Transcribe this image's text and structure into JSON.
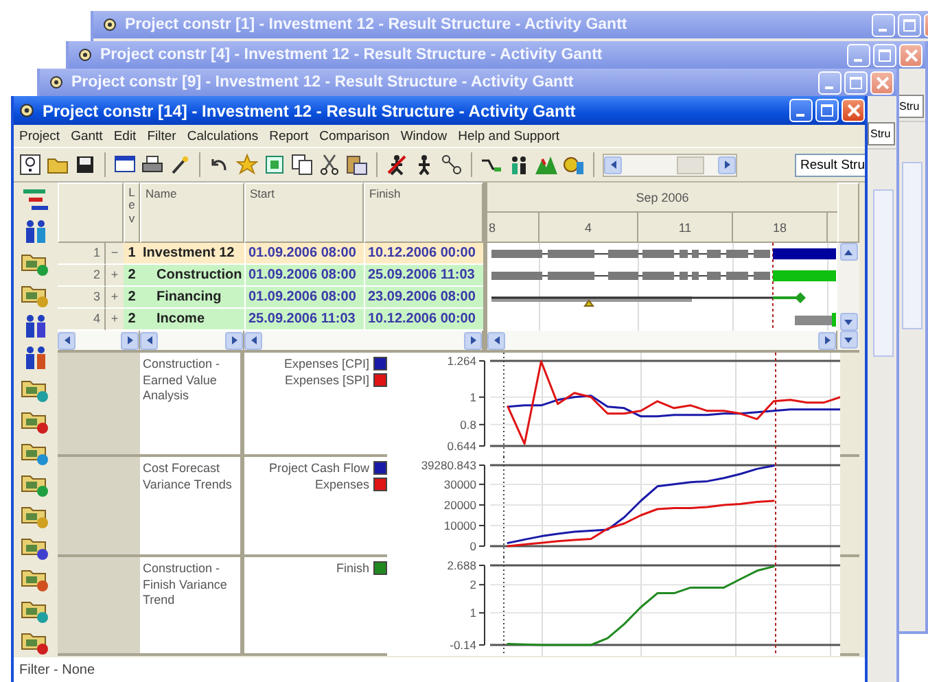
{
  "windows_behind": [
    {
      "title": "Project constr [1] - Investment 12 - Result Structure - Activity Gantt"
    },
    {
      "title": "Project constr [4] - Investment 12 - Result Structure - Activity Gantt",
      "dropdown_value": "Stru"
    },
    {
      "title": "Project constr [9] - Investment 12 - Result Structure - Activity Gantt",
      "dropdown_value": "Stru"
    }
  ],
  "window": {
    "title": "Project constr [14] - Investment 12 - Result Structure - Activity Gantt"
  },
  "menu": [
    "Project",
    "Gantt",
    "Edit",
    "Filter",
    "Calculations",
    "Report",
    "Comparison",
    "Window",
    "Help and Support"
  ],
  "toolbar": {
    "dropdown_value": "Result Stru"
  },
  "table": {
    "columns": [
      "Lev",
      "Name",
      "Start",
      "Finish"
    ],
    "rows": [
      {
        "number": "1",
        "toggle": "−",
        "lev": "1",
        "name": "Investment 12",
        "start": "01.09.2006 08:00",
        "finish": "10.12.2006 00:00",
        "kind": "summary",
        "bar": {
          "kind": "split-bar",
          "color": "#00009c"
        }
      },
      {
        "number": "2",
        "toggle": "+",
        "lev": "2",
        "name": "Construction",
        "start": "01.09.2006 08:00",
        "finish": "25.09.2006 11:03",
        "kind": "task",
        "bar": {
          "kind": "split-bar",
          "color": "#10c010"
        }
      },
      {
        "number": "3",
        "toggle": "+",
        "lev": "2",
        "name": "Financing",
        "start": "01.09.2006 08:00",
        "finish": "23.09.2006 08:00",
        "kind": "task",
        "bar": {
          "kind": "line",
          "color": "#20a020"
        }
      },
      {
        "number": "4",
        "toggle": "+",
        "lev": "2",
        "name": "Income",
        "start": "25.09.2006 11:03",
        "finish": "10.12.2006 00:00",
        "kind": "task",
        "bar": {
          "kind": "late-bar",
          "color": "#10c010"
        }
      }
    ]
  },
  "gantt": {
    "month": "Sep 2006",
    "days": [
      "8",
      "4",
      "11",
      "18"
    ]
  },
  "charts": [
    {
      "title": "Construction - Earned Value Analysis",
      "chart_data": {
        "type": "line",
        "grid": true,
        "legend": "left",
        "ylim": [
          0.644,
          1.264
        ],
        "yticks": [
          0.644,
          0.8,
          1,
          1.264
        ],
        "series": [
          {
            "name": "Expenses [CPI]",
            "color": "#1a1aa8",
            "values": [
              0.93,
              0.94,
              0.94,
              0.98,
              1.0,
              1.01,
              0.93,
              0.92,
              0.86,
              0.86,
              0.87,
              0.87,
              0.87,
              0.88,
              0.88,
              0.89,
              0.9,
              0.91,
              0.91,
              0.91,
              0.91
            ]
          },
          {
            "name": "Expenses [SPI]",
            "color": "#e01414",
            "values": [
              0.93,
              0.66,
              1.26,
              0.95,
              1.03,
              1.0,
              0.88,
              0.88,
              0.9,
              0.97,
              0.92,
              0.94,
              0.9,
              0.9,
              0.88,
              0.84,
              0.97,
              0.98,
              0.96,
              0.96,
              1.0
            ]
          }
        ]
      }
    },
    {
      "title": "Cost Forecast Variance Trends",
      "chart_data": {
        "type": "line",
        "grid": true,
        "legend": "left",
        "ylim": [
          0,
          39280.843
        ],
        "yticks": [
          0,
          10000,
          20000,
          30000,
          39280.843
        ],
        "series": [
          {
            "name": "Project Cash Flow",
            "color": "#1a1aa8",
            "values": [
              1500,
              3200,
              4800,
              6000,
              7000,
              7500,
              8000,
              14000,
              22000,
              29000,
              30000,
              31000,
              31500,
              33000,
              35000,
              37500,
              39000,
              null,
              null,
              null,
              null
            ]
          },
          {
            "name": "Expenses",
            "color": "#e01414",
            "values": [
              0,
              800,
              1600,
              2400,
              3000,
              3500,
              8500,
              11000,
              15000,
              18000,
              18500,
              18500,
              19000,
              20000,
              20500,
              21500,
              22000,
              null,
              null,
              null,
              null
            ]
          }
        ]
      }
    },
    {
      "title": "Construction - Finish Variance Trend",
      "chart_data": {
        "type": "line",
        "grid": true,
        "legend": "left",
        "ylim": [
          -0.14,
          2.688
        ],
        "yticks": [
          -0.14,
          1,
          2,
          2.688
        ],
        "series": [
          {
            "name": "Finish",
            "color": "#208a20",
            "values": [
              -0.1,
              -0.12,
              -0.14,
              -0.14,
              -0.14,
              -0.14,
              0.1,
              0.6,
              1.2,
              1.7,
              1.7,
              1.9,
              1.9,
              1.9,
              2.2,
              2.5,
              2.65,
              null,
              null,
              null,
              null
            ]
          }
        ]
      }
    }
  ],
  "status_bar": "Filter - None"
}
